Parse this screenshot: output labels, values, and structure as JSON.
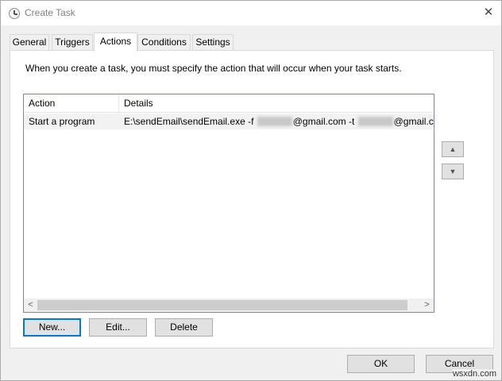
{
  "window": {
    "title": "Create Task",
    "close_glyph": "✕"
  },
  "tabs": [
    {
      "label": "General"
    },
    {
      "label": "Triggers"
    },
    {
      "label": "Actions",
      "active": true
    },
    {
      "label": "Conditions"
    },
    {
      "label": "Settings"
    }
  ],
  "actions_panel": {
    "intro": "When you create a task, you must specify the action that will occur when your task starts.",
    "columns": {
      "action": "Action",
      "details": "Details"
    },
    "rows": [
      {
        "action": "Start a program",
        "details_prefix": "E:\\sendEmail\\sendEmail.exe -f ",
        "details_mid": "@gmail.com -t ",
        "details_suffix": "@gmail.com"
      }
    ],
    "scroll_left_glyph": "<",
    "scroll_right_glyph": ">",
    "move_up_glyph": "▲",
    "move_down_glyph": "▼",
    "buttons": {
      "new": "New...",
      "edit": "Edit...",
      "delete": "Delete"
    }
  },
  "footer": {
    "ok": "OK",
    "cancel": "Cancel"
  },
  "watermark": "wsxdn.com",
  "colors": {
    "focus_border": "#0078d7",
    "window_bg": "#f0f0f0"
  }
}
